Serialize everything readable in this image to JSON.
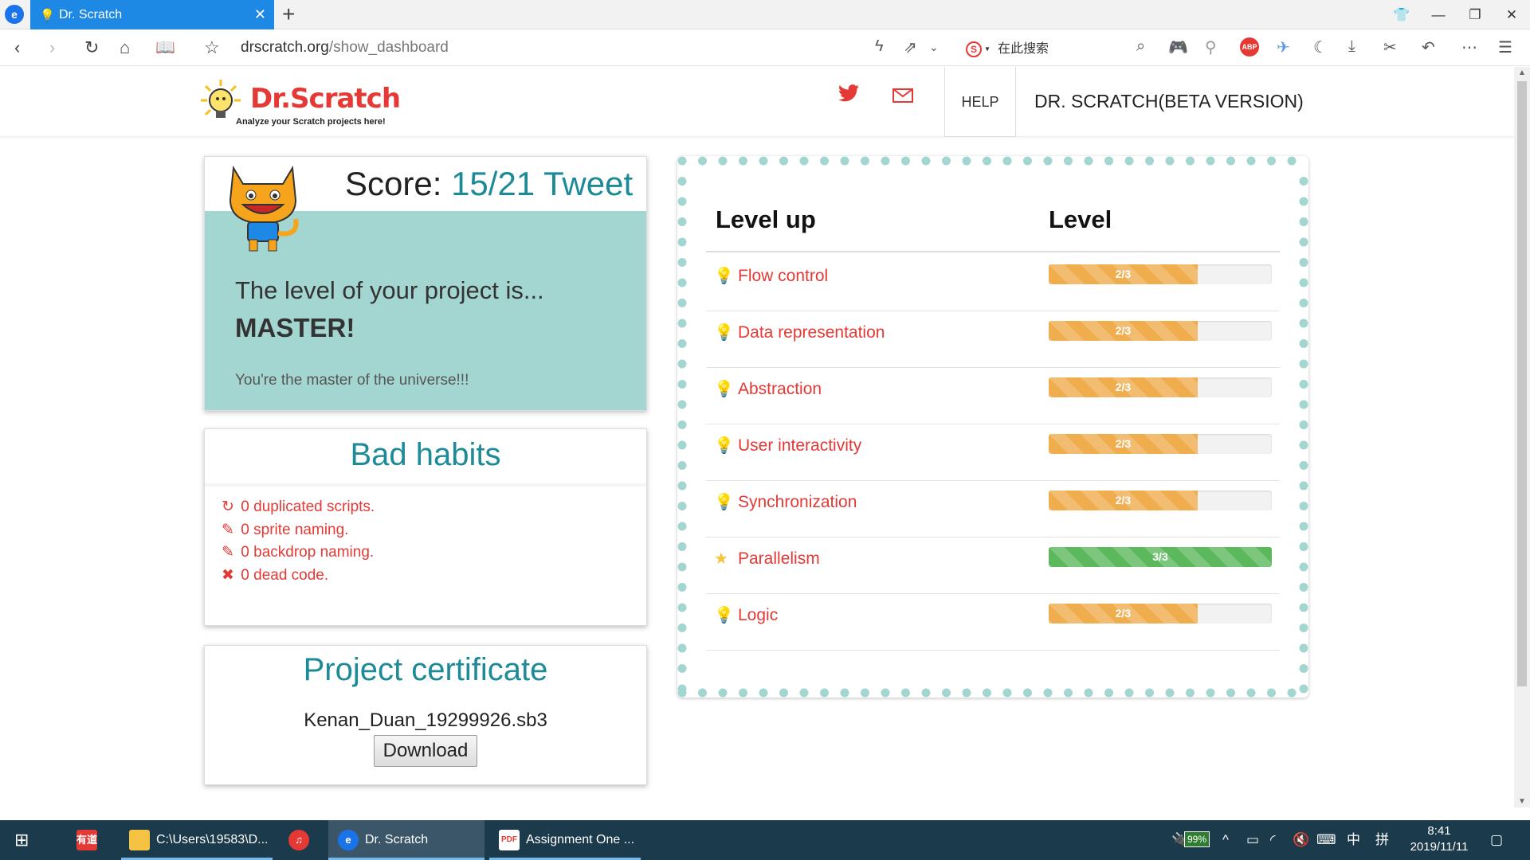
{
  "browser": {
    "tab_title": "Dr. Scratch",
    "url_host": "drscratch.org",
    "url_path": "/show_dashboard",
    "search_placeholder": "在此搜索"
  },
  "header": {
    "logo_text": "Dr.Scratch",
    "logo_tagline": "Analyze your Scratch projects here!",
    "help_label": "HELP",
    "brand_label": "DR. SCRATCH(BETA VERSION)"
  },
  "score": {
    "label": "Score:",
    "value": "15/21",
    "tweet": "Tweet",
    "level_intro": "The level of your project is...",
    "level_name": "MASTER!",
    "level_message": "You're the master of the universe!!!"
  },
  "bad_habits": {
    "title": "Bad habits",
    "items": [
      {
        "icon": "refresh-icon",
        "text": "0 duplicated scripts."
      },
      {
        "icon": "pencil-icon",
        "text": "0 sprite naming."
      },
      {
        "icon": "pencil-icon",
        "text": "0 backdrop naming."
      },
      {
        "icon": "remove-circle-icon",
        "text": "0 dead code."
      }
    ]
  },
  "certificate": {
    "title": "Project certificate",
    "filename": "Kenan_Duan_19299926.sb3",
    "download_label": "Download"
  },
  "levels": {
    "col_name": "Level up",
    "col_level": "Level",
    "rows": [
      {
        "name": "Flow control",
        "icon": "lightbulb-icon",
        "label": "2/3",
        "fraction": 0.667,
        "color": "#f0ad4e"
      },
      {
        "name": "Data representation",
        "icon": "lightbulb-icon",
        "label": "2/3",
        "fraction": 0.667,
        "color": "#f0ad4e"
      },
      {
        "name": "Abstraction",
        "icon": "lightbulb-icon",
        "label": "2/3",
        "fraction": 0.667,
        "color": "#f0ad4e"
      },
      {
        "name": "User interactivity",
        "icon": "lightbulb-icon",
        "label": "2/3",
        "fraction": 0.667,
        "color": "#f0ad4e"
      },
      {
        "name": "Synchronization",
        "icon": "lightbulb-icon",
        "label": "2/3",
        "fraction": 0.667,
        "color": "#f0ad4e"
      },
      {
        "name": "Parallelism",
        "icon": "star-icon",
        "label": "3/3",
        "fraction": 1.0,
        "color": "#5cb85c"
      },
      {
        "name": "Logic",
        "icon": "lightbulb-icon",
        "label": "2/3",
        "fraction": 0.667,
        "color": "#f0ad4e"
      }
    ]
  },
  "taskbar": {
    "explorer_label": "C:\\Users\\19583\\D...",
    "browser_label": "Dr. Scratch",
    "pdf_label": "Assignment One ...",
    "youdao_label": "有道",
    "battery": "99%",
    "ime": "中",
    "ime2": "拼",
    "time": "8:41",
    "date": "2019/11/11"
  },
  "colors": {
    "accent_teal": "#1c8b97",
    "score_panel": "#a4d6d1",
    "brand_red": "#e53935",
    "progress_orange": "#f0ad4e",
    "progress_green": "#5cb85c",
    "tab_blue": "#1e88e5"
  }
}
